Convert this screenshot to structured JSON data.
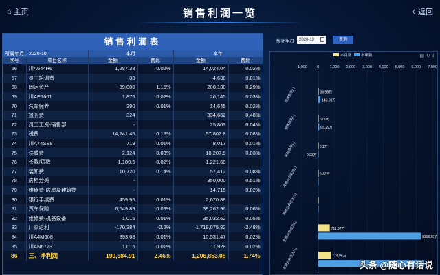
{
  "header": {
    "home_label": "主页",
    "title": "销售利润一览",
    "back_label": "返回"
  },
  "table": {
    "title": "销售利润表",
    "period_label": "所属年月：2020-10",
    "group_month": "本月",
    "group_year": "本年",
    "col_no": "序号",
    "col_name": "项目名称",
    "col_amount": "金额",
    "col_ratio": "费比",
    "rows": [
      {
        "no": "66",
        "name": "川A644H6",
        "m_amt": "1,287.38",
        "m_ratio": "0.02%",
        "y_amt": "14,024.04",
        "y_ratio": "0.02%"
      },
      {
        "no": "67",
        "name": "员工培训费",
        "m_amt": "-38",
        "m_ratio": "",
        "y_amt": "4,638",
        "y_ratio": "0.01%"
      },
      {
        "no": "68",
        "name": "固定资产",
        "m_amt": "89,000",
        "m_ratio": "1.15%",
        "y_amt": "200,130",
        "y_ratio": "0.29%"
      },
      {
        "no": "69",
        "name": "川AE1601",
        "m_amt": "1,875",
        "m_ratio": "0.02%",
        "y_amt": "20,145",
        "y_ratio": "0.03%"
      },
      {
        "no": "70",
        "name": "汽车保养",
        "m_amt": "390",
        "m_ratio": "0.01%",
        "y_amt": "14,645",
        "y_ratio": "0.02%"
      },
      {
        "no": "71",
        "name": "报刊费",
        "m_amt": "324",
        "m_ratio": "",
        "y_amt": "334,662",
        "y_ratio": "0.48%"
      },
      {
        "no": "72",
        "name": "员工工资-销售部",
        "m_amt": "-",
        "m_ratio": "",
        "y_amt": "25,803",
        "y_ratio": "0.04%"
      },
      {
        "no": "73",
        "name": "税费",
        "m_amt": "14,241.45",
        "m_ratio": "0.18%",
        "y_amt": "57,802.8",
        "y_ratio": "0.08%"
      },
      {
        "no": "74",
        "name": "川A74SE8",
        "m_amt": "719",
        "m_ratio": "0.01%",
        "y_amt": "8,017",
        "y_ratio": "0.01%"
      },
      {
        "no": "75",
        "name": "误餐费",
        "m_amt": "2,124",
        "m_ratio": "0.03%",
        "y_amt": "18,207.9",
        "y_ratio": "0.03%"
      },
      {
        "no": "76",
        "name": "长款/短款",
        "m_amt": "-1,189.5",
        "m_ratio": "-0.02%",
        "y_amt": "1,221.68",
        "y_ratio": ""
      },
      {
        "no": "77",
        "name": "装卸费",
        "m_amt": "10,720",
        "m_ratio": "0.14%",
        "y_amt": "57,412",
        "y_ratio": "0.08%"
      },
      {
        "no": "78",
        "name": "房租分摊",
        "m_amt": "-",
        "m_ratio": "",
        "y_amt": "350,000",
        "y_ratio": "0.51%"
      },
      {
        "no": "79",
        "name": "维修费-房屋及建筑物",
        "m_amt": "-",
        "m_ratio": "",
        "y_amt": "14,715",
        "y_ratio": "0.02%"
      },
      {
        "no": "80",
        "name": "银行手续费",
        "m_amt": "459.95",
        "m_ratio": "0.01%",
        "y_amt": "2,670.88",
        "y_ratio": ""
      },
      {
        "no": "81",
        "name": "汽车保险",
        "m_amt": "6,649.89",
        "m_ratio": "0.09%",
        "y_amt": "39,262.96",
        "y_ratio": "0.06%"
      },
      {
        "no": "82",
        "name": "维修费-机器设备",
        "m_amt": "1,015",
        "m_ratio": "0.01%",
        "y_amt": "35,032.62",
        "y_ratio": "0.05%"
      },
      {
        "no": "83",
        "name": "厂家返利",
        "m_amt": "-170,384",
        "m_ratio": "-2.2%",
        "y_amt": "-1,719,075.82",
        "y_ratio": "-2.48%"
      },
      {
        "no": "84",
        "name": "川A4M608",
        "m_amt": "893.68",
        "m_ratio": "0.01%",
        "y_amt": "10,531.47",
        "y_ratio": "0.02%"
      },
      {
        "no": "85",
        "name": "川AN6723",
        "m_amt": "1,015",
        "m_ratio": "0.01%",
        "y_amt": "11,928",
        "y_ratio": "0.02%"
      }
    ],
    "total": {
      "no": "86",
      "name": "三、净利润",
      "m_amt": "190,684.91",
      "m_ratio": "2.46%",
      "y_amt": "1,206,853.08",
      "y_ratio": "1.74%"
    }
  },
  "filter": {
    "label": "统计年月",
    "value": "2020-10",
    "query_label": "查询"
  },
  "chart_data": {
    "type": "bar",
    "orientation": "horizontal",
    "categories": [
      "运营费用(-)",
      "销售费用(-)",
      "采购费用(-)",
      "其他业务支出(-)",
      "其他业务收入(+)",
      "主营业务成本(-)",
      "主营业务收入(+)"
    ],
    "series": [
      {
        "name": "本月数",
        "color": "#f5e08a",
        "values": [
          36.55,
          6.09,
          0.1,
          0.32,
          0,
          711.97,
          774.09
        ],
        "labels": [
          "36.55万",
          "6.09万",
          "0.1万",
          "0.32万",
          "",
          "711.97万",
          "774.09万"
        ]
      },
      {
        "name": "本年数",
        "color": "#4d9fe6",
        "values": [
          143.09,
          65.29,
          -0.23,
          0,
          0,
          6296.03,
          6500
        ],
        "labels": [
          "143.09万",
          "65.29万",
          "-0.23万",
          "",
          "",
          "6296.03万",
          ""
        ]
      }
    ],
    "xticks": [
      -1000,
      0,
      1000,
      2000,
      3000,
      4000,
      5000,
      6000,
      7000
    ],
    "xtick_labels": [
      "-1,000",
      "0",
      "1,000",
      "2,000",
      "3,000",
      "4,000",
      "5,000",
      "6,000",
      "7,000"
    ],
    "xlim": [
      -1000,
      7000
    ],
    "legend_position": "top"
  },
  "watermark": {
    "text": "头条 @随心有话说"
  }
}
